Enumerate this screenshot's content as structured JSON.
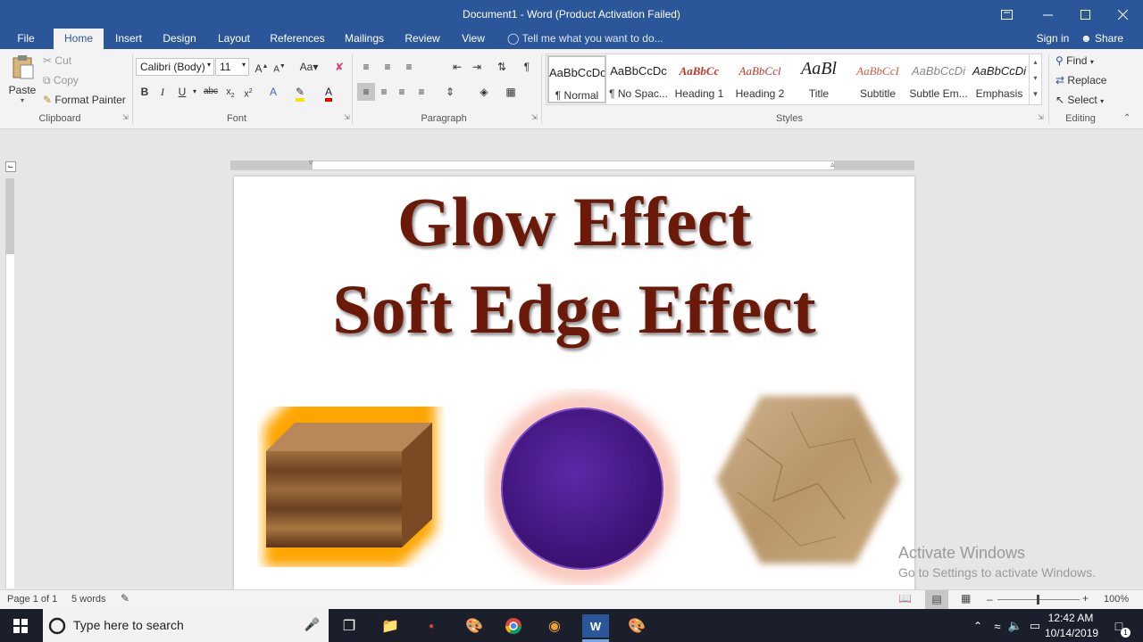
{
  "window": {
    "title": "Document1 - Word (Product Activation Failed)",
    "signin": "Sign in",
    "share": "Share"
  },
  "tabs": [
    "File",
    "Home",
    "Insert",
    "Design",
    "Layout",
    "References",
    "Mailings",
    "Review",
    "View"
  ],
  "tell_me": "Tell me what you want to do...",
  "clipboard": {
    "paste": "Paste",
    "cut": "Cut",
    "copy": "Copy",
    "format_painter": "Format Painter",
    "label": "Clipboard"
  },
  "font": {
    "name": "Calibri (Body)",
    "size": "11",
    "label": "Font"
  },
  "paragraph": {
    "label": "Paragraph"
  },
  "styles": {
    "label": "Styles",
    "items": [
      {
        "preview": "AaBbCcDc",
        "name": "¶ Normal"
      },
      {
        "preview": "AaBbCcDc",
        "name": "¶ No Spac..."
      },
      {
        "preview": "AaBbCc",
        "name": "Heading 1"
      },
      {
        "preview": "AaBbCcl",
        "name": "Heading 2"
      },
      {
        "preview": "AaBl",
        "name": "Title"
      },
      {
        "preview": "AaBbCcI",
        "name": "Subtitle"
      },
      {
        "preview": "AaBbCcDi",
        "name": "Subtle Em..."
      },
      {
        "preview": "AaBbCcDi",
        "name": "Emphasis"
      }
    ]
  },
  "editing": {
    "find": "Find",
    "replace": "Replace",
    "select": "Select",
    "label": "Editing"
  },
  "document": {
    "line1": "Glow Effect",
    "line2": "Soft Edge Effect"
  },
  "watermark": {
    "line1": "Activate Windows",
    "line2": "Go to Settings to activate Windows."
  },
  "status": {
    "page": "Page 1 of 1",
    "words": "5 words",
    "zoom": "100%"
  },
  "taskbar": {
    "search_placeholder": "Type here to search",
    "time": "12:42 AM",
    "date": "10/14/2019",
    "notif_count": "1"
  },
  "colors": {
    "brand": "#2b579a",
    "heading_text": "#6b1a0a",
    "glow_orange": "#ffa500",
    "circle_purple": "#4a1a8c"
  }
}
